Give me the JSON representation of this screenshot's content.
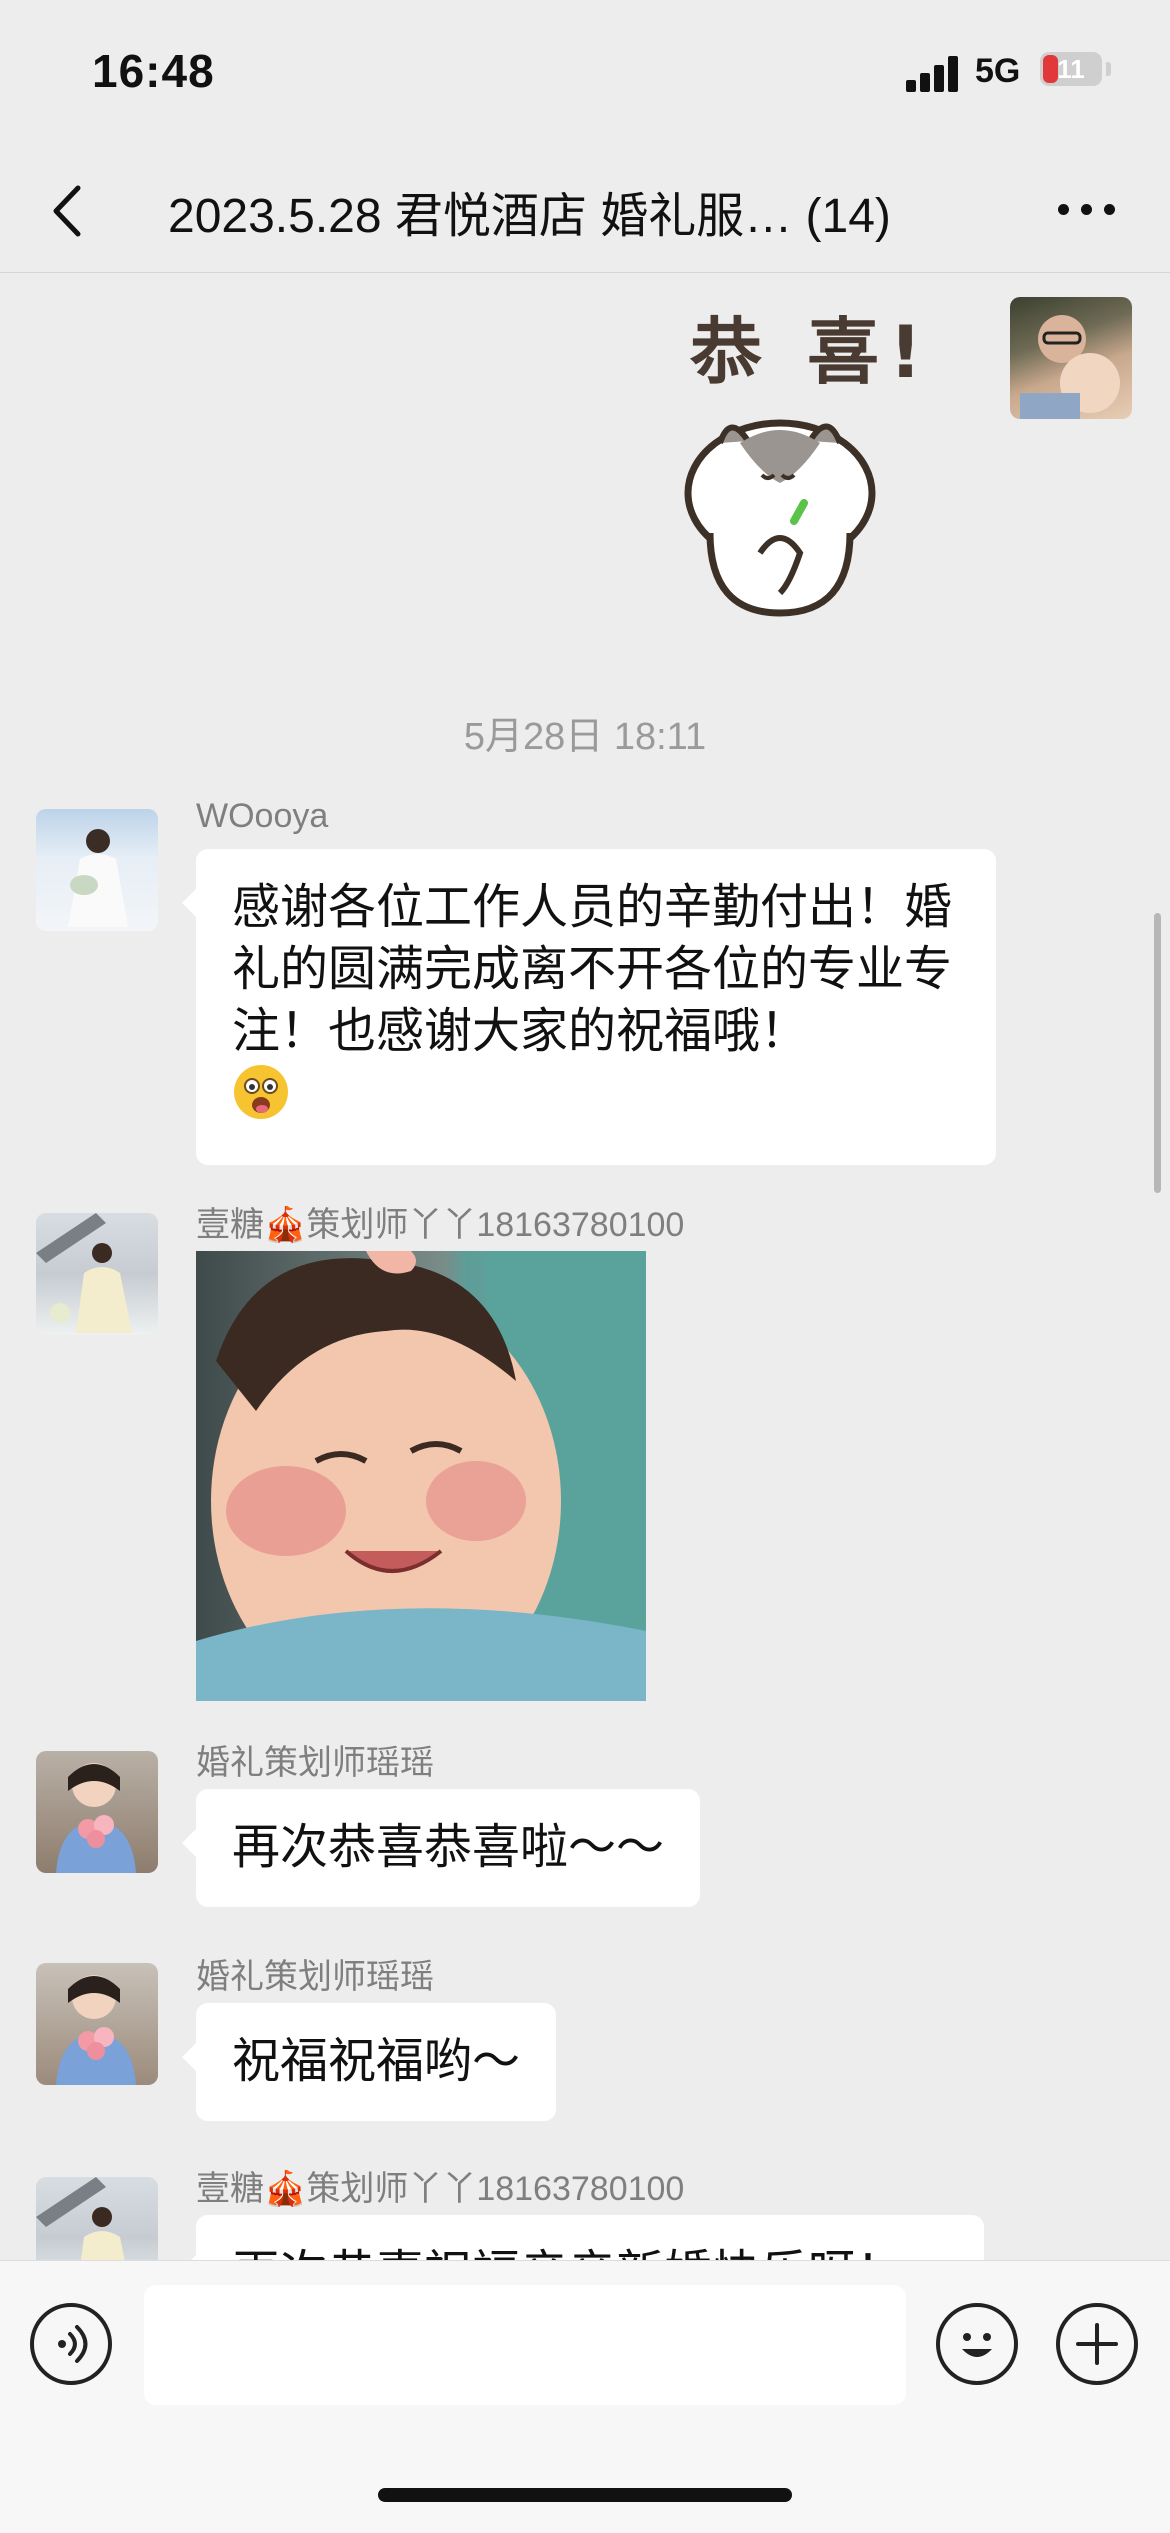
{
  "status_bar": {
    "time": "16:48",
    "network": "5G",
    "battery": "11"
  },
  "nav": {
    "title": "2023.5.28 君悦酒店 婚礼服…  (14)"
  },
  "messages": {
    "sticker_text": "恭 喜!",
    "timestamp": "5月28日 18:11",
    "msg1": {
      "sender": "WOooya",
      "text": "感谢各位工作人员的辛勤付出！婚礼的圆满完成离不开各位的专业专注！也感谢大家的祝福哦！"
    },
    "msg2": {
      "sender": "壹糖🎪策划师丫丫18163780100"
    },
    "msg3": {
      "sender": "婚礼策划师瑶瑶",
      "text": "再次恭喜恭喜啦～～"
    },
    "msg4": {
      "sender": "婚礼策划师瑶瑶",
      "text": "祝福祝福哟～"
    },
    "msg5": {
      "sender": "壹糖🎪策划师丫丫18163780100",
      "text": "再次恭喜祝福亲亲新婚快乐呀！"
    }
  },
  "icons": {
    "back": "chevron-left-icon",
    "more": "more-icon",
    "voice": "voice-icon",
    "emoji": "emoji-icon",
    "plus": "plus-icon"
  }
}
